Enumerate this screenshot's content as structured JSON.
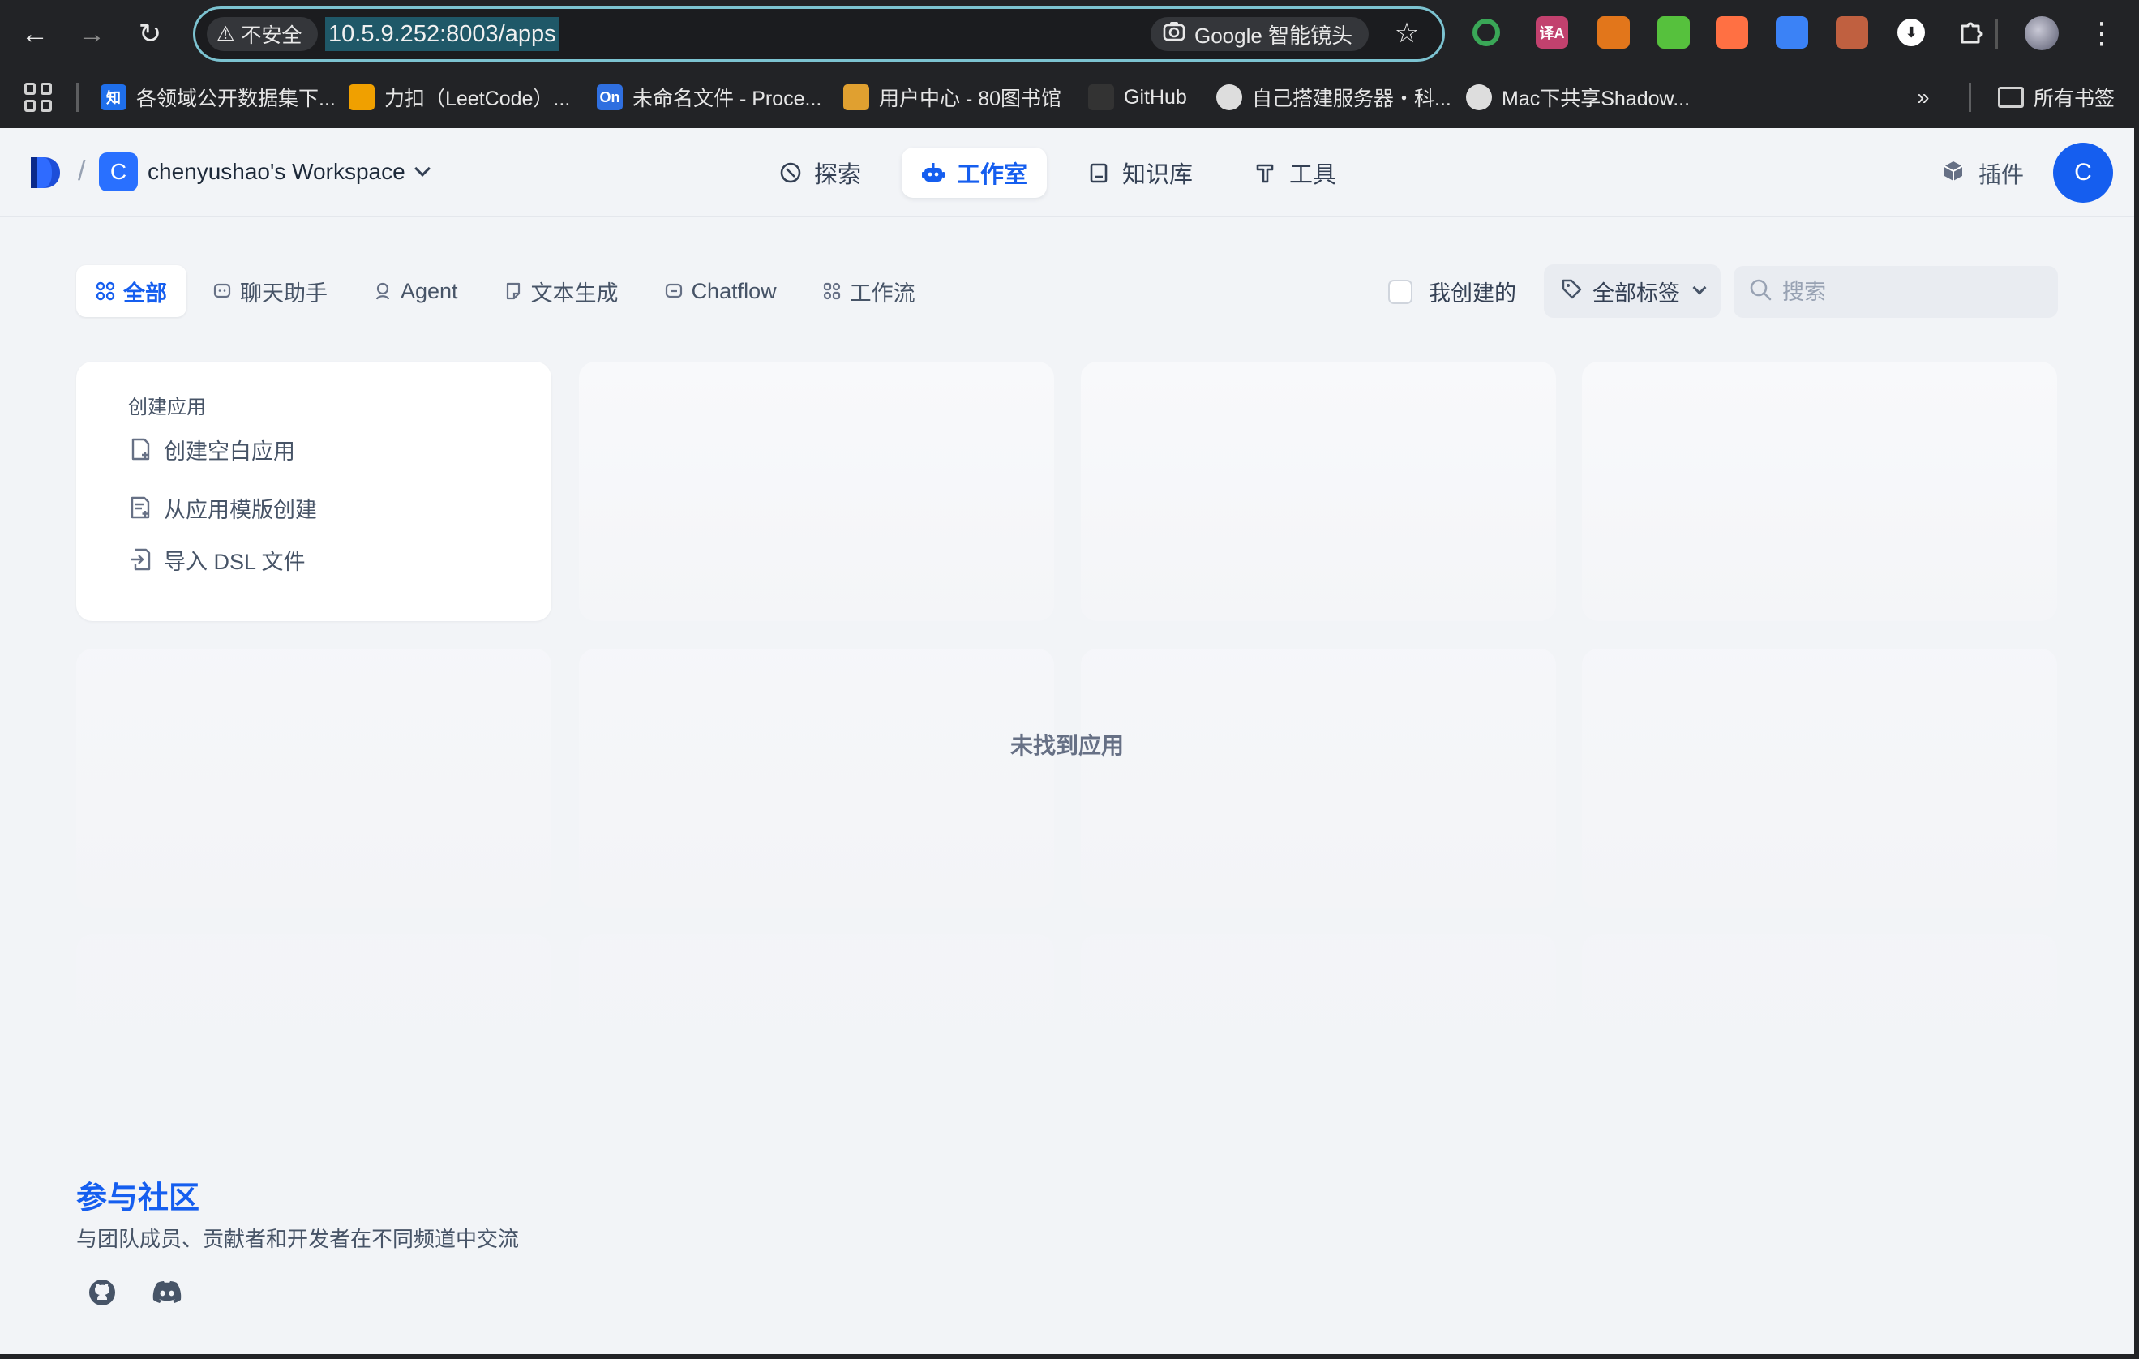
{
  "browser": {
    "security_label": "不安全",
    "url": "10.5.9.252:8003/apps",
    "lens_label": "Google 智能镜头",
    "bookmarks": [
      {
        "label": "各领域公开数据集下...",
        "icon_text": "知",
        "color": "#1f6feb"
      },
      {
        "label": "力扣（LeetCode）...",
        "icon_text": "",
        "color": "#f0a000"
      },
      {
        "label": "未命名文件 - Proce...",
        "icon_text": "On",
        "color": "#2f6fe0"
      },
      {
        "label": "用户中心 - 80图书馆",
        "icon_text": "",
        "color": "#e0a030"
      },
      {
        "label": "GitHub",
        "icon_text": "",
        "color": "#333333"
      },
      {
        "label": "自己搭建服务器・科...",
        "icon_text": "",
        "color": "#dddddd"
      },
      {
        "label": "Mac下共享Shadow...",
        "icon_text": "",
        "color": "#dddddd"
      }
    ],
    "all_bookmarks_label": "所有书签",
    "ext_icons": [
      {
        "name": "green-ring-extension-icon",
        "text": "",
        "color": "#3aa757"
      },
      {
        "name": "translate-extension-icon",
        "text": "译A",
        "color": "#c2416e"
      },
      {
        "name": "fox-extension-icon",
        "text": "",
        "color": "#e2761b"
      },
      {
        "name": "grid-extension-icon",
        "text": "",
        "color": "#56c13d"
      },
      {
        "name": "pen-extension-icon",
        "text": "",
        "color": "#ff7043"
      },
      {
        "name": "link-extension-icon",
        "text": "",
        "color": "#3b82f6"
      },
      {
        "name": "film-extension-icon",
        "text": "",
        "color": "#c06040"
      },
      {
        "name": "download-icon",
        "text": "⬇",
        "color": "#ffffff"
      },
      {
        "name": "puzzle-icon",
        "text": "",
        "color": "#222326"
      }
    ]
  },
  "header": {
    "workspace_initial": "C",
    "workspace_name": "chenyushao's Workspace",
    "nav": [
      {
        "key": "explore",
        "label": "探索"
      },
      {
        "key": "studio",
        "label": "工作室"
      },
      {
        "key": "datasets",
        "label": "知识库"
      },
      {
        "key": "tools",
        "label": "工具"
      }
    ],
    "plugins_label": "插件",
    "user_initial": "C"
  },
  "filters": {
    "tabs": [
      {
        "key": "all",
        "label": "全部"
      },
      {
        "key": "chat",
        "label": "聊天助手"
      },
      {
        "key": "agent",
        "label": "Agent"
      },
      {
        "key": "completion",
        "label": "文本生成"
      },
      {
        "key": "chatflow",
        "label": "Chatflow"
      },
      {
        "key": "workflow",
        "label": "工作流"
      }
    ],
    "created_by_me_label": "我创建的",
    "tags_label": "全部标签",
    "search_placeholder": "搜索"
  },
  "create_card": {
    "title": "创建应用",
    "items": [
      {
        "key": "blank",
        "label": "创建空白应用"
      },
      {
        "key": "template",
        "label": "从应用模版创建"
      },
      {
        "key": "import",
        "label": "导入 DSL 文件"
      }
    ]
  },
  "empty_text": "未找到应用",
  "community": {
    "title": "参与社区",
    "description": "与团队成员、贡献者和开发者在不同频道中交流"
  },
  "colors": {
    "accent": "#155eef",
    "background": "#f2f4f7"
  }
}
